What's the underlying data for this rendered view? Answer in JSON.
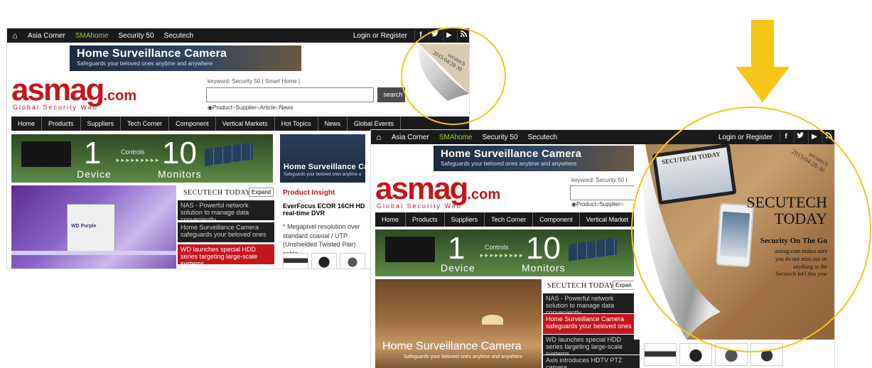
{
  "topbar": {
    "links": [
      "Asia Corner",
      "SMAhome",
      "Security 50",
      "Secutech"
    ],
    "login": "Login or Register",
    "social": [
      "f",
      "t",
      "▶",
      "rss"
    ]
  },
  "banner": {
    "title": "Home Surveillance Camera",
    "subtitle": "Safeguards your beloved ones anytime and anywhere"
  },
  "logo": {
    "main": "asmag",
    "suffix": ".com",
    "tagline": "Global Security Web"
  },
  "search": {
    "keyword_line": "keyword: Security 50 | Smart Home |",
    "keyword_line_short": "keyword: Security 50 |",
    "button": "search",
    "radios": [
      "Product",
      "Supplier",
      "Article",
      "News"
    ]
  },
  "nav": [
    "Home",
    "Products",
    "Suppliers",
    "Tech Corner",
    "Component",
    "Vertical Markets",
    "Hot Topics",
    "News",
    "Global Events"
  ],
  "nav_right": [
    "Home",
    "Products",
    "Suppliers",
    "Tech Corner",
    "Component",
    "Vertical Market"
  ],
  "promo": {
    "n1": "1",
    "controls": "Controls",
    "arrows": "►►►►►►►►►",
    "n10": "10",
    "device": "Device",
    "monitors": "Monitors"
  },
  "secutech_today": {
    "heading": "SECUTECH TODAY",
    "expand": "Expand",
    "expand_short": "Expan",
    "items_left": [
      "NAS - Powerful network solution to manage data conveniently",
      "Home Surveillance Camera safeguards your beloved ones",
      "WD launches special HDD series targeting large-scale systems"
    ],
    "items_right": [
      "NAS - Powerful network solution to manage data conveniently",
      "Home Surveillance Camera safeguards your beloved ones",
      "WD launches special HDD series targeting large-scale systems",
      "Axis introduces HDTV PTZ camera"
    ]
  },
  "hdd_label": "WD Purple",
  "side_banner": {
    "title": "Home Surveillance Cam",
    "subtitle": "Safeguards your beloved ones anytime a"
  },
  "insight": {
    "heading": "Product Insight",
    "title": "EverFocus ECOR 16CH HD real-time DVR",
    "desc": "* Megapixel resolution over standard coaxial / UTP (Unshielded Twisted Pair) cable"
  },
  "scene": {
    "title": "Home Surveillance Camera",
    "subtitle": "Safeguards your beloved ones anytime and anywhere"
  },
  "stamp": {
    "brand": "secutech",
    "date": "2015/04/28-30"
  },
  "peel_ad": {
    "magazine": "SECUTECH TODAY",
    "title1": "SECUTECH",
    "title2": "TODAY",
    "heading": "Security On The Go",
    "body": [
      "asmag.com makes sure",
      "you do not miss out on",
      "anything in the",
      "Secutech Int'l this year"
    ]
  },
  "colors": {
    "brand_red": "#c4161c",
    "highlight_yellow": "#f5c518",
    "nav_dark": "#1a1a1a",
    "sma_green": "#9bd33a"
  }
}
